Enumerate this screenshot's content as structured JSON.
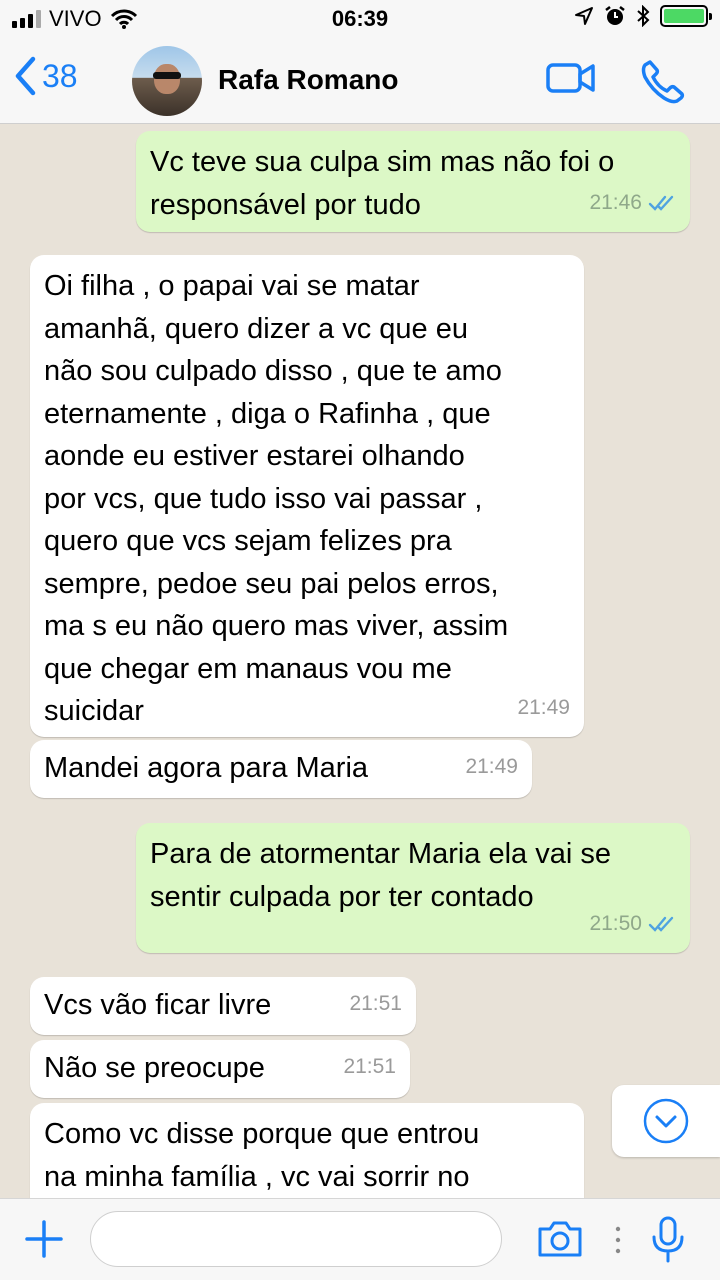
{
  "status_bar": {
    "carrier": "VIVO",
    "time": "06:39"
  },
  "header": {
    "back_count": "38",
    "contact_name": "Rafa Romano"
  },
  "messages": [
    {
      "dir": "out",
      "text": "Vc teve sua culpa sim mas não foi o\nresponsável por tudo",
      "time": "21:46",
      "read": true
    },
    {
      "dir": "in",
      "text": "Oi filha , o papai vai se matar\namanhã, quero dizer a vc que eu\nnão sou culpado disso , que te amo\neternamente , diga o Rafinha , que\naonde eu estiver estarei olhando\npor vcs, que tudo isso vai passar ,\nquero que vcs sejam felizes pra\nsempre, pedoe seu pai pelos erros,\nma s eu não quero mas viver, assim\nque chegar em manaus vou me\nsuicidar",
      "time": "21:49"
    },
    {
      "dir": "in",
      "text": "Mandei agora para Maria",
      "time": "21:49"
    },
    {
      "dir": "out",
      "text": "Para de atormentar Maria ela vai se\nsentir culpada por ter contado",
      "time": "21:50",
      "read": true
    },
    {
      "dir": "in",
      "text": "Vcs vão ficar livre",
      "time": "21:51"
    },
    {
      "dir": "in",
      "text": "Não se preocupe",
      "time": "21:51"
    },
    {
      "dir": "in",
      "text": "Como vc disse porque que entrou\nna minha família , vc vai sorrir no",
      "time": ""
    }
  ],
  "input": {
    "placeholder": ""
  },
  "colors": {
    "accent": "#1a7ff6",
    "outgoing_bubble": "#dcf8c6",
    "incoming_bubble": "#ffffff",
    "chat_background": "#e8e2d8",
    "read_ticks": "#4fa3e0"
  },
  "icons": [
    "signal-icon",
    "wifi-icon",
    "location-icon",
    "alarm-icon",
    "bluetooth-icon",
    "battery-icon",
    "back-chevron-icon",
    "video-call-icon",
    "phone-icon",
    "scroll-down-icon",
    "plus-icon",
    "camera-icon",
    "more-icon",
    "microphone-icon"
  ]
}
